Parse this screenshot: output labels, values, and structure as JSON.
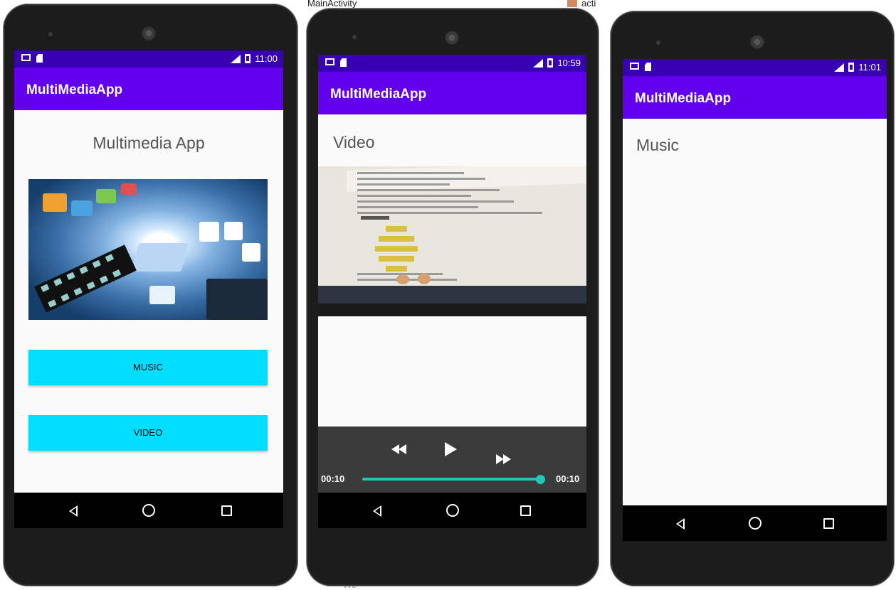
{
  "desktop": {
    "top_left_text": "MainActivity",
    "top_right_text": "acti",
    "bottom_text": "Wo"
  },
  "phones": [
    {
      "status_time": "11:00",
      "app_title": "MultiMediaApp",
      "heading": "Multimedia App",
      "buttons": {
        "music": "MUSIC",
        "video": "VIDEO"
      },
      "colors": {
        "status_bar": "#3700b3",
        "app_bar": "#6200ee",
        "button": "#00ddff"
      }
    },
    {
      "status_time": "10:59",
      "app_title": "MultiMediaApp",
      "heading": "Video",
      "player": {
        "elapsed": "00:10",
        "duration": "00:10",
        "progress": 1.0
      },
      "colors": {
        "seek_bar": "#1fc7b8",
        "controls_bg": "#3b3b3b"
      }
    },
    {
      "status_time": "11:01",
      "app_title": "MultiMediaApp",
      "heading": "Music"
    }
  ],
  "icons": {
    "status_left": [
      "mail-icon",
      "sd-card-icon"
    ],
    "status_right": [
      "lte-signal-icon",
      "battery-icon"
    ],
    "nav": [
      "back-icon",
      "home-icon",
      "recents-icon"
    ],
    "player": [
      "rewind-icon",
      "play-icon",
      "fast-forward-icon"
    ]
  }
}
